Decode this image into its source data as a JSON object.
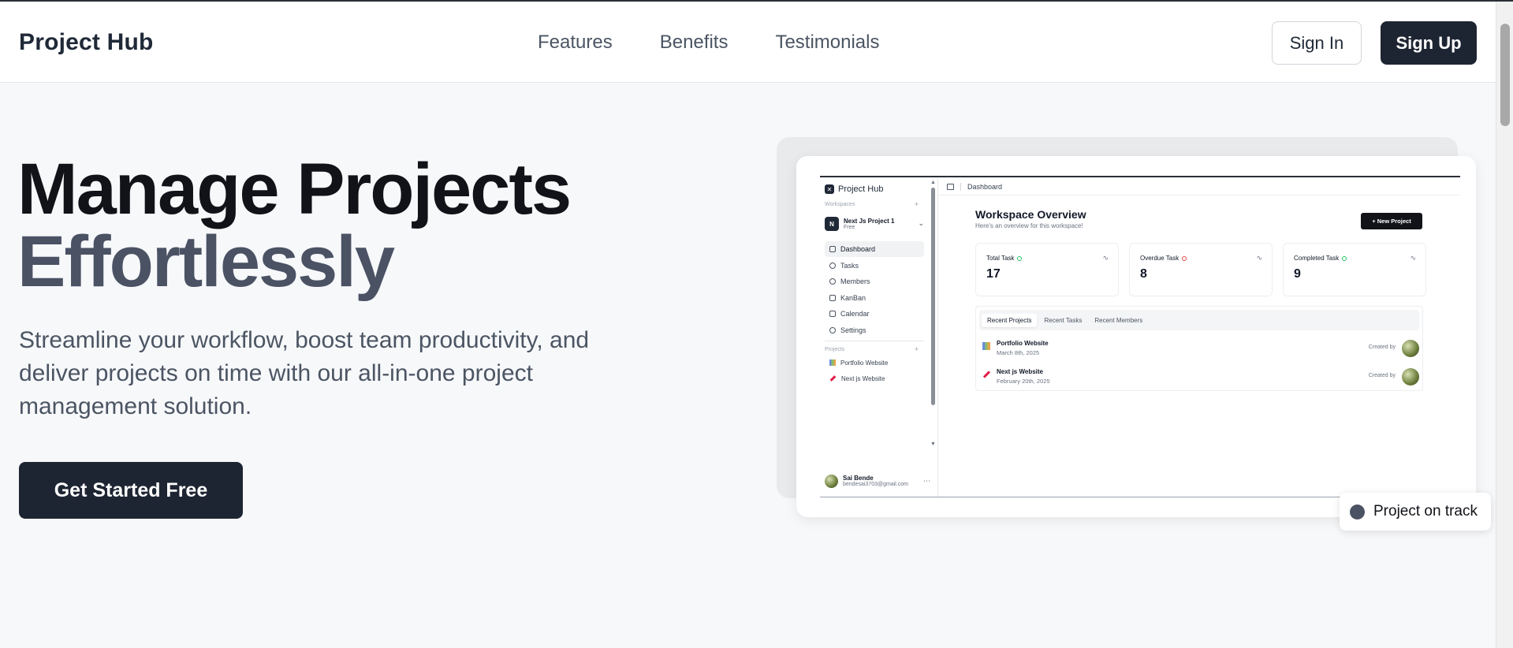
{
  "nav": {
    "brand": "Project Hub",
    "links": [
      "Features",
      "Benefits",
      "Testimonials"
    ],
    "sign_in": "Sign In",
    "sign_up": "Sign Up"
  },
  "hero": {
    "title_line1": "Manage Projects",
    "title_line2": "Effortlessly",
    "subtitle": "Streamline your workflow, boost team productivity, and deliver projects on time with our all-in-one project management solution.",
    "cta": "Get Started Free"
  },
  "preview": {
    "brand": "Project Hub",
    "workspaces_caption": "Workspaces",
    "workspace": {
      "avatar": "N",
      "name": "Next Js Project 1",
      "plan": "Free"
    },
    "nav_items": [
      "Dashboard",
      "Tasks",
      "Members",
      "KanBan",
      "Calendar",
      "Settings"
    ],
    "projects_caption": "Projects",
    "projects": [
      "Portfolio Website",
      "Next js Website"
    ],
    "user": {
      "name": "Sai Bende",
      "email": "bendesai3703@gmail.com"
    },
    "breadcrumb": "Dashboard",
    "heading": "Workspace Overview",
    "heading_sub": "Here's an overview for this workspace!",
    "new_project": "+ New Project",
    "stats": [
      {
        "label": "Total Task",
        "value": "17",
        "status": "green"
      },
      {
        "label": "Overdue Task",
        "value": "8",
        "status": "red"
      },
      {
        "label": "Completed Task",
        "value": "9",
        "status": "green"
      }
    ],
    "tabs": [
      "Recent Projects",
      "Recent Tasks",
      "Recent Members"
    ],
    "recent_projects": [
      {
        "title": "Portfolio Website",
        "date": "March 8th, 2025",
        "created_by": "Created by"
      },
      {
        "title": "Next js Website",
        "date": "February 20th, 2025",
        "created_by": "Created by"
      }
    ]
  },
  "badge": {
    "text": "Project on track"
  },
  "colors": {
    "primary": "#1e2532",
    "muted_heading": "#4a5264",
    "success": "#22c55e",
    "danger": "#ef4444"
  }
}
